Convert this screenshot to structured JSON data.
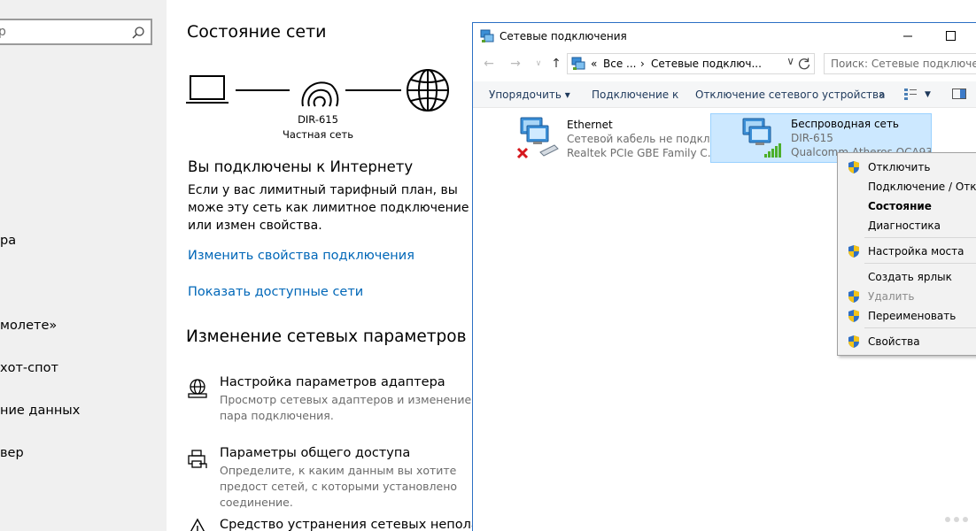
{
  "sidebar": {
    "search_placeholder": "р",
    "items": [
      "ра",
      "молете»",
      "хот-спот",
      "ние данных",
      "вер"
    ]
  },
  "status": {
    "title": "Состояние сети",
    "router_name": "DIR-615",
    "router_type": "Частная сеть",
    "connected_heading": "Вы подключены к Интернету",
    "description": "Если у вас лимитный тарифный план, вы може эту сеть как лимитное подключение или измен свойства.",
    "link_change_properties": "Изменить свойства подключения",
    "link_show_networks": "Показать доступные сети"
  },
  "change_section": {
    "title": "Изменение сетевых параметров",
    "options": [
      {
        "icon": "adapter-globe-icon",
        "title": "Настройка параметров адаптера",
        "desc": "Просмотр сетевых адаптеров и изменение пара подключения."
      },
      {
        "icon": "sharing-printer-icon",
        "title": "Параметры общего доступа",
        "desc": "Определите, к каким данным вы хотите предост сетей, с которыми установлено соединение."
      },
      {
        "icon": "troubleshoot-warning-icon",
        "title": "Средство устранения сетевых неполадок",
        "desc": ""
      }
    ]
  },
  "explorer": {
    "title": "Сетевые подключения",
    "address": {
      "chevron": "«",
      "segments": [
        "Все ...",
        "›",
        "Сетевые подключ..."
      ]
    },
    "search_placeholder": "Поиск: Сетевые подключения",
    "commands": [
      "Упорядочить ▾",
      "Подключение к",
      "Отключение сетевого устройства",
      "»"
    ],
    "items": [
      {
        "name": "Ethernet",
        "line1": "Сетевой кабель не подкл...",
        "line2": "Realtek PCIe GBE Family C...",
        "selected": false
      },
      {
        "name": "Беспроводная сеть",
        "line1": "DIR-615",
        "line2": "Qualcomm Atheros QCA93...",
        "selected": true
      }
    ]
  },
  "context_menu": {
    "items": [
      {
        "label": "Отключить",
        "shield": true,
        "bold": false,
        "disabled": false
      },
      {
        "label": "Подключение / Откл",
        "shield": false,
        "bold": false,
        "disabled": false
      },
      {
        "label": "Состояние",
        "shield": false,
        "bold": true,
        "disabled": false
      },
      {
        "label": "Диагностика",
        "shield": false,
        "bold": false,
        "disabled": false
      },
      {
        "label": "Настройка моста",
        "shield": true,
        "bold": false,
        "disabled": false
      },
      {
        "label": "Создать ярлык",
        "shield": false,
        "bold": false,
        "disabled": false
      },
      {
        "label": "Удалить",
        "shield": true,
        "bold": false,
        "disabled": true
      },
      {
        "label": "Переименовать",
        "shield": true,
        "bold": false,
        "disabled": false
      },
      {
        "label": "Свойства",
        "shield": true,
        "bold": false,
        "disabled": false
      }
    ]
  },
  "colors": {
    "link": "#0067b8",
    "selection": "#cce8ff",
    "window_border": "#2b6fc4"
  }
}
